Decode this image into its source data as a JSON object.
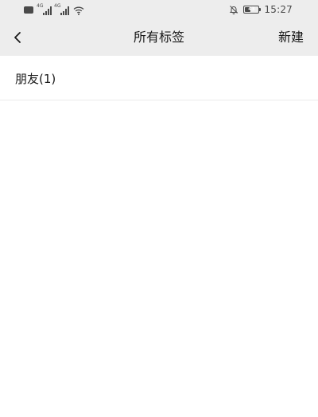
{
  "status_bar": {
    "time": "15:27",
    "battery_level": "43",
    "battery_fraction": 0.43,
    "network_labels": [
      "4G",
      "4G"
    ],
    "icons": [
      "hd-badge-icon",
      "signal-icon",
      "signal-icon",
      "wifi-icon",
      "bell-muted-icon",
      "battery-icon"
    ]
  },
  "nav": {
    "back_icon": "chevron-left-icon",
    "title": "所有标签",
    "new_label": "新建"
  },
  "tags": [
    {
      "label": "朋友(1)"
    }
  ],
  "colors": {
    "header_bg": "#ededed",
    "page_bg": "#ffffff",
    "text": "#1a1a1a",
    "divider": "#ececec"
  }
}
